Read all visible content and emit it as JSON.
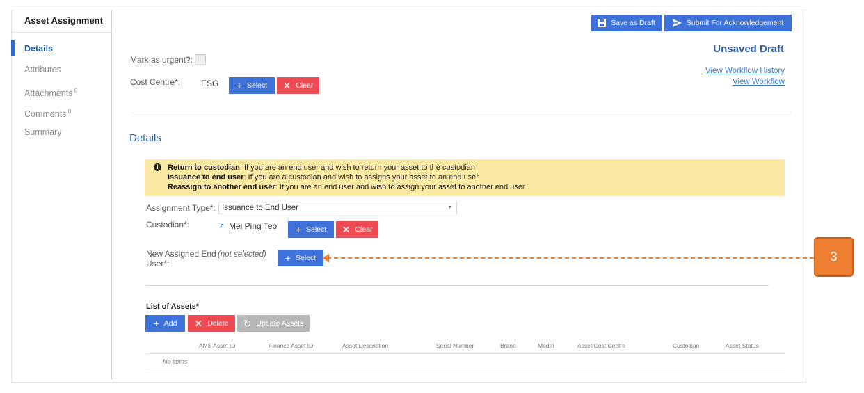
{
  "app_title": "Asset Assignment",
  "nav": [
    {
      "label": "Details",
      "count": ""
    },
    {
      "label": "Attributes",
      "count": ""
    },
    {
      "label": "Attachments",
      "count": "0"
    },
    {
      "label": "Comments",
      "count": "0"
    },
    {
      "label": "Summary",
      "count": ""
    }
  ],
  "toolbar": {
    "save_draft": "Save as Draft",
    "submit": "Submit For Acknowledgement"
  },
  "status": "Unsaved Draft",
  "links": {
    "workflow_history": "View Workflow History",
    "workflow": "View Workflow"
  },
  "form": {
    "urgent_label": "Mark as urgent?:",
    "cost_centre_label": "Cost Centre*:",
    "cost_centre_value": "ESG",
    "select_label": "Select",
    "clear_label": "Clear"
  },
  "details": {
    "title": "Details",
    "notice": [
      {
        "bold": "Return to custodian",
        "text": ": If you are an end user and wish to return your asset to the custodian"
      },
      {
        "bold": "Issuance to end user",
        "text": ": If you are a custodian and wish to assigns your asset to an end user"
      },
      {
        "bold": "Reassign to another end user",
        "text": ": If you are an end user and wish to assign your asset to another end user"
      }
    ],
    "assignment_type_label": "Assignment Type*:",
    "assignment_type_value": "Issuance to End User",
    "custodian_label": "Custodian*:",
    "custodian_value": "Mei Ping Teo",
    "end_user_label_1": "New Assigned End",
    "end_user_label_2": "User*:",
    "end_user_value": "(not selected)"
  },
  "assets": {
    "title": "List of Assets*",
    "add_label": "Add",
    "delete_label": "Delete",
    "update_label": "Update Assets",
    "columns": [
      "AMS Asset ID",
      "Finance Asset ID",
      "Asset Description",
      "Serial Number",
      "Brand",
      "Model",
      "Asset Cost Centre",
      "Custodian",
      "Asset Status"
    ],
    "empty_text": "No items"
  },
  "callout": {
    "number": "3",
    "color": "#ED7D31"
  },
  "colors": {
    "primary": "#3F72D9",
    "danger": "#EE4A54",
    "accent": "#2E5FA8",
    "warning_bg": "#FCE9A3"
  }
}
